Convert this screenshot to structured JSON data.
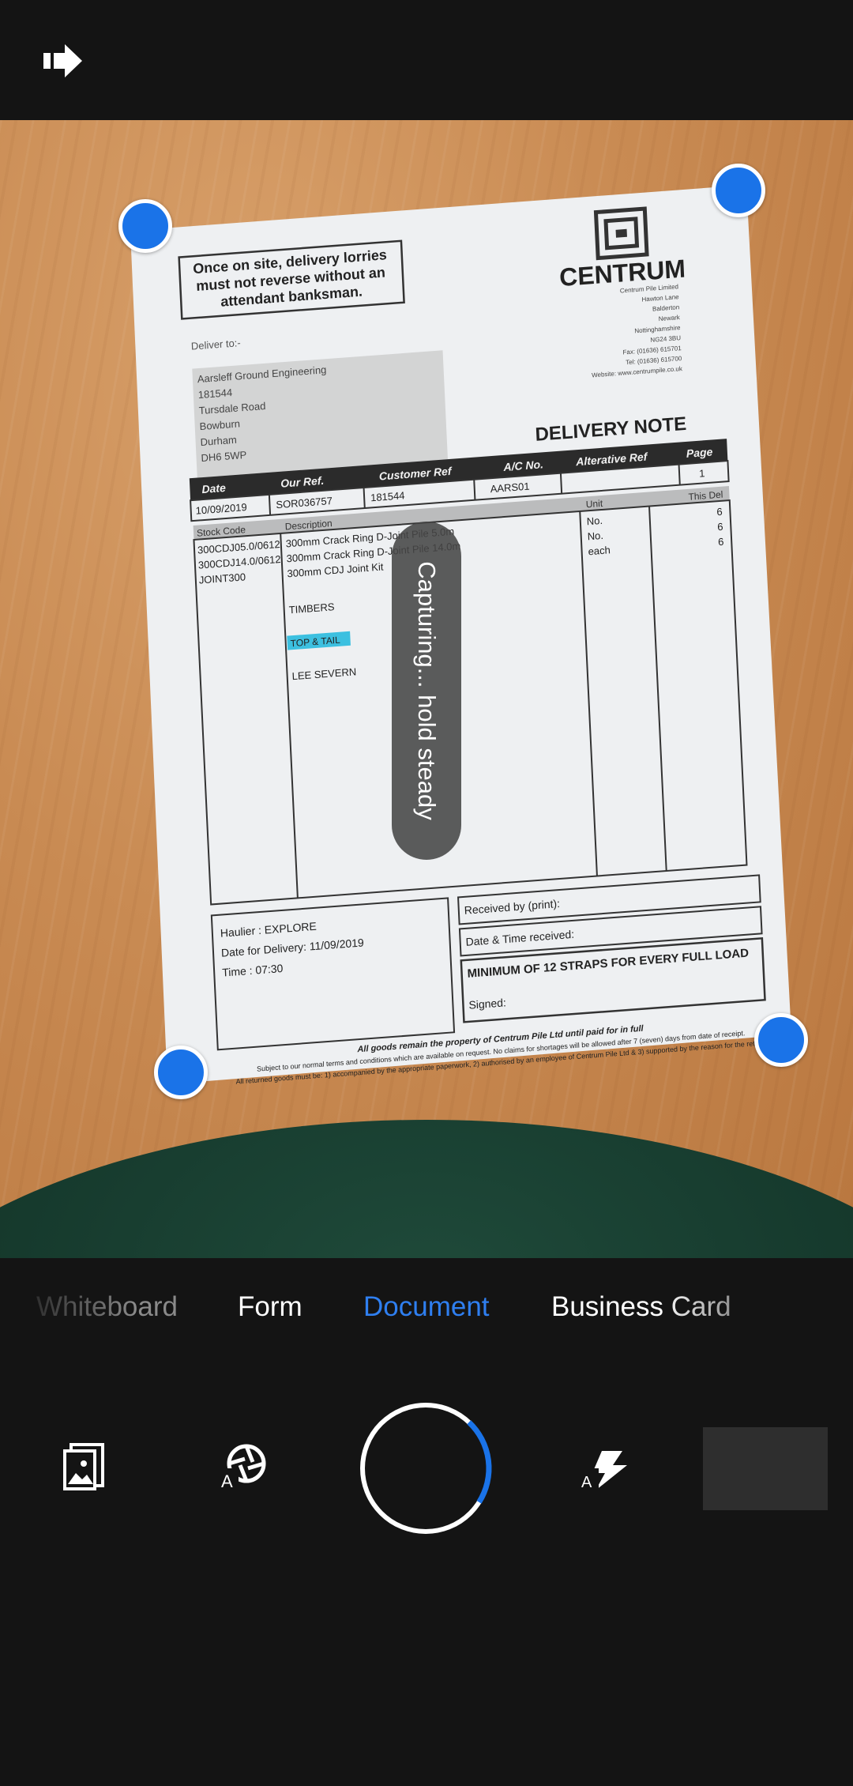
{
  "top_bar": {
    "exit_icon": "exit-arrow-icon"
  },
  "document": {
    "notice": [
      "Once on site, delivery lorries",
      "must not reverse without an",
      "attendant banksman."
    ],
    "brand": "CENTRUM",
    "company_address": [
      "Centrum Pile Limited",
      "Hawton Lane",
      "Balderton",
      "Newark",
      "Nottinghamshire",
      "NG24 3BU",
      "Fax: (01636) 615701",
      "Tel: (01636) 615700",
      "Website: www.centrumpile.co.uk"
    ],
    "deliver_to_label": "Deliver to:-",
    "deliver_to": [
      "Aarsleff Ground Engineering",
      "181544",
      "Tursdale Road",
      "Bowburn",
      "Durham",
      "DH6 5WP"
    ],
    "title": "DELIVERY NOTE",
    "header_cols": [
      "Date",
      "Our Ref.",
      "Customer Ref",
      "A/C No.",
      "Alterative Ref",
      "Page"
    ],
    "header_vals": [
      "10/09/2019",
      "SOR036757",
      "181544",
      "AARS01",
      "",
      "1"
    ],
    "line_cols": [
      "Stock Code",
      "Description",
      "Unit",
      "This Del"
    ],
    "lines": [
      {
        "code": "300CDJ05.0/0612",
        "desc": "300mm Crack Ring D-Joint Pile 5.0m",
        "unit": "No.",
        "qty": "6"
      },
      {
        "code": "300CDJ14.0/0612",
        "desc": "300mm Crack Ring D-Joint Pile 14.0m",
        "unit": "No.",
        "qty": "6"
      },
      {
        "code": "JOINT300",
        "desc": "300mm CDJ Joint Kit",
        "unit": "each",
        "qty": "6"
      }
    ],
    "notes": [
      "TIMBERS",
      "TOP & TAIL",
      "LEE SEVERN"
    ],
    "haulier": "Haulier :  EXPLORE",
    "delivery_date": "Date for Delivery:  11/09/2019",
    "time": "Time :  07:30",
    "received_by": "Received by (print):",
    "date_time_received": "Date & Time received:",
    "straps": "MINIMUM OF 12 STRAPS FOR EVERY FULL LOAD",
    "signed": "Signed:",
    "footer": [
      "All goods remain the property of Centrum Pile Ltd until paid for in full",
      "Subject to our normal terms and conditions which are available on request. No claims for shortages will be allowed after 7 (seven) days from date of receipt.",
      "All returned goods must be: 1) accompanied by the appropriate paperwork, 2) authorised by an employee of Centrum Pile Ltd & 3) supported by the reason for the return."
    ]
  },
  "capture_status": "Capturing... hold steady",
  "modes": {
    "items": [
      "Whiteboard",
      "Form",
      "Document",
      "Business Card"
    ],
    "selected": "Document"
  },
  "controls": {
    "import_icon": "import-photo-icon",
    "auto_capture_icon": "auto-capture-icon",
    "shutter_icon": "shutter-button",
    "flash_icon": "flash-auto-icon",
    "capture_progress": 0.22
  },
  "colors": {
    "accent": "#1a73e8",
    "background": "#141414",
    "text": "#ffffff"
  }
}
